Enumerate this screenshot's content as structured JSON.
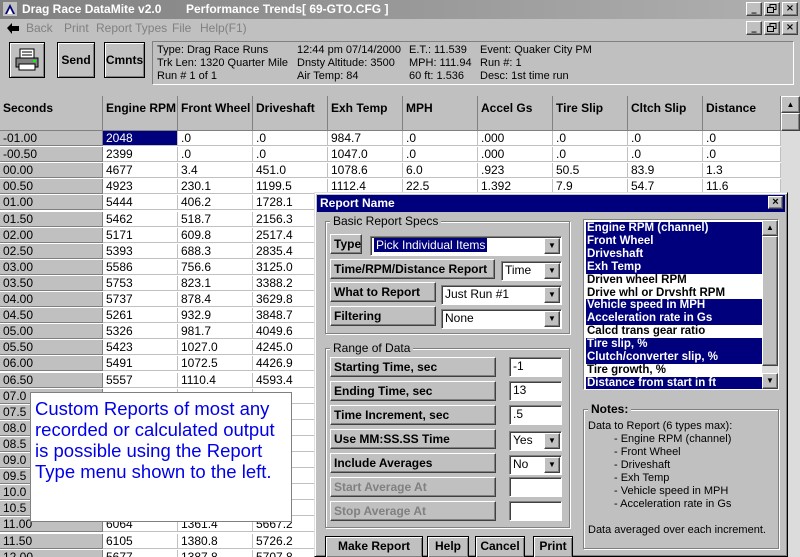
{
  "window": {
    "app_title": "Drag Race DataMite v2.0",
    "product": "Performance Trends",
    "file": "[ 69-GTO.CFG ]",
    "buttons": [
      "_",
      "×"
    ],
    "mdi_buttons": [
      "_",
      "×"
    ]
  },
  "menu": {
    "items": [
      "Back",
      "Print",
      "Report Types",
      "File",
      "Help(F1)"
    ]
  },
  "toolbar": {
    "send_label": "Send",
    "comments_label": "Cmnts",
    "info": {
      "type": "Type: Drag Race Runs",
      "track": "Trk Len: 1320  Quarter Mile",
      "run": "Run #  1 of 1",
      "datetime": "12:44 pm 07/14/2000",
      "density_altitude": "Dnsty Altitude: 3500",
      "air_temp": "Air Temp: 84",
      "et": "E.T.: 11.539",
      "mph": "MPH: 111.94",
      "sixty_ft": "60 ft: 1.536",
      "event": "Event: Quaker City PM",
      "run_num": "Run #: 1",
      "desc": "Desc: 1st time run"
    }
  },
  "grid": {
    "columns": [
      "Seconds",
      "Engine RPM",
      "Front Wheel",
      "Driveshaft",
      "Exh Temp",
      "MPH",
      "Accel Gs",
      "Tire Slip",
      "Cltch Slip",
      "Distance"
    ],
    "rows": [
      [
        "-01.00",
        "2048",
        ".0",
        ".0",
        "984.7",
        ".0",
        ".000",
        ".0",
        ".0",
        ".0"
      ],
      [
        "-00.50",
        "2399",
        ".0",
        ".0",
        "1047.0",
        ".0",
        ".000",
        ".0",
        ".0",
        ".0"
      ],
      [
        "00.00",
        "4677",
        "3.4",
        "451.0",
        "1078.6",
        "6.0",
        ".923",
        "50.5",
        "83.9",
        "1.3"
      ],
      [
        "00.50",
        "4923",
        "230.1",
        "1199.5",
        "1112.4",
        "22.5",
        "1.392",
        "7.9",
        "54.7",
        "11.6"
      ],
      [
        "01.00",
        "5444",
        "406.2",
        "1728.1",
        "",
        "",
        "",
        "",
        "",
        ""
      ],
      [
        "01.50",
        "5462",
        "518.7",
        "2156.3",
        "",
        "",
        "",
        "",
        "",
        ""
      ],
      [
        "02.00",
        "5171",
        "609.8",
        "2517.4",
        "",
        "",
        "",
        "",
        "",
        ""
      ],
      [
        "02.50",
        "5393",
        "688.3",
        "2835.4",
        "",
        "",
        "",
        "",
        "",
        ""
      ],
      [
        "03.00",
        "5586",
        "756.6",
        "3125.0",
        "",
        "",
        "",
        "",
        "",
        ""
      ],
      [
        "03.50",
        "5753",
        "823.1",
        "3388.2",
        "",
        "",
        "",
        "",
        "",
        ""
      ],
      [
        "04.00",
        "5737",
        "878.4",
        "3629.8",
        "",
        "",
        "",
        "",
        "",
        ""
      ],
      [
        "04.50",
        "5261",
        "932.9",
        "3848.7",
        "",
        "",
        "",
        "",
        "",
        ""
      ],
      [
        "05.00",
        "5326",
        "981.7",
        "4049.6",
        "",
        "",
        "",
        "",
        "",
        ""
      ],
      [
        "05.50",
        "5423",
        "1027.0",
        "4245.0",
        "",
        "",
        "",
        "",
        "",
        ""
      ],
      [
        "06.00",
        "5491",
        "1072.5",
        "4426.9",
        "",
        "",
        "",
        "",
        "",
        ""
      ],
      [
        "06.50",
        "5557",
        "1110.4",
        "4593.4",
        "",
        "",
        "",
        "",
        "",
        ""
      ],
      [
        "07.0",
        "",
        "",
        "",
        "",
        "",
        "",
        "",
        "",
        ""
      ],
      [
        "07.5",
        "",
        "",
        "",
        "",
        "",
        "",
        "",
        "",
        ""
      ],
      [
        "08.0",
        "",
        "",
        "",
        "",
        "",
        "",
        "",
        "",
        ""
      ],
      [
        "08.5",
        "",
        "",
        "",
        "",
        "",
        "",
        "",
        "",
        ""
      ],
      [
        "09.0",
        "",
        "",
        "",
        "",
        "",
        "",
        "",
        "",
        ""
      ],
      [
        "09.5",
        "",
        "",
        "",
        "",
        "",
        "",
        "",
        "",
        ""
      ],
      [
        "10.0",
        "",
        "",
        "",
        "",
        "",
        "",
        "",
        "",
        ""
      ],
      [
        "10.5",
        "",
        "",
        "",
        "",
        "",
        "",
        "",
        "",
        ""
      ],
      [
        "11.00",
        "6064",
        "1361.4",
        "5667.2",
        "",
        "",
        "",
        "",
        "",
        ""
      ],
      [
        "11.50",
        "6105",
        "1380.8",
        "5726.2",
        "",
        "",
        "",
        "",
        "",
        ""
      ],
      [
        "12.00",
        "5677",
        "1387.8",
        "5707.8",
        "",
        "",
        "",
        "",
        "",
        ""
      ]
    ]
  },
  "callout": {
    "text": "Custom Reports of most any recorded or calculated output is possible using the Report Type menu shown to the left."
  },
  "dialog": {
    "title": "Report Name",
    "basic_title": "Basic Report Specs",
    "type_label": "Type",
    "type_value": "Pick Individual Items",
    "trd_label": "Time/RPM/Distance Report",
    "trd_value": "Time",
    "what_label": "What to Report",
    "what_value": "Just Run #1",
    "filter_label": "Filtering",
    "filter_value": "None",
    "range_title": "Range of Data",
    "start_label": "Starting Time, sec",
    "start_value": "-1",
    "end_label": "Ending Time, sec",
    "end_value": "13",
    "inc_label": "Time Increment, sec",
    "inc_value": ".5",
    "mm_label": "Use MM:SS.SS Time",
    "mm_value": "Yes",
    "avg_label": "Include Averages",
    "avg_value": "No",
    "start_avg_label": "Start Average At",
    "stop_avg_label": "Stop Average At",
    "list_items": [
      {
        "label": "Engine RPM (channel)",
        "selected": true
      },
      {
        "label": "Front Wheel",
        "selected": true
      },
      {
        "label": "Driveshaft",
        "selected": true
      },
      {
        "label": "Exh Temp",
        "selected": true
      },
      {
        "label": "Driven wheel RPM",
        "selected": false
      },
      {
        "label": "Drive whl or Drvshft RPM",
        "selected": false
      },
      {
        "label": "Vehicle speed in MPH",
        "selected": true
      },
      {
        "label": "Acceleration rate in Gs",
        "selected": true
      },
      {
        "label": "Calcd trans gear ratio",
        "selected": false
      },
      {
        "label": "Tire slip, %",
        "selected": true
      },
      {
        "label": "Clutch/converter slip, %",
        "selected": true
      },
      {
        "label": "Tire growth, %",
        "selected": false
      },
      {
        "label": "Distance from start in ft",
        "selected": true
      }
    ],
    "notes_title": "Notes:",
    "notes_lines": [
      "Data to Report (6 types max):",
      "- Engine RPM (channel)",
      "- Front Wheel",
      "- Driveshaft",
      "- Exh Temp",
      "- Vehicle speed in MPH",
      "- Acceleration rate in Gs",
      "Data averaged over each increment."
    ],
    "buttons": {
      "make_report": "Make Report",
      "help": "Help",
      "cancel": "Cancel",
      "print": "Print"
    }
  },
  "colors": {
    "selection": "#00007c",
    "callout_text": "#0000e8",
    "face": "#c0c0c0"
  }
}
